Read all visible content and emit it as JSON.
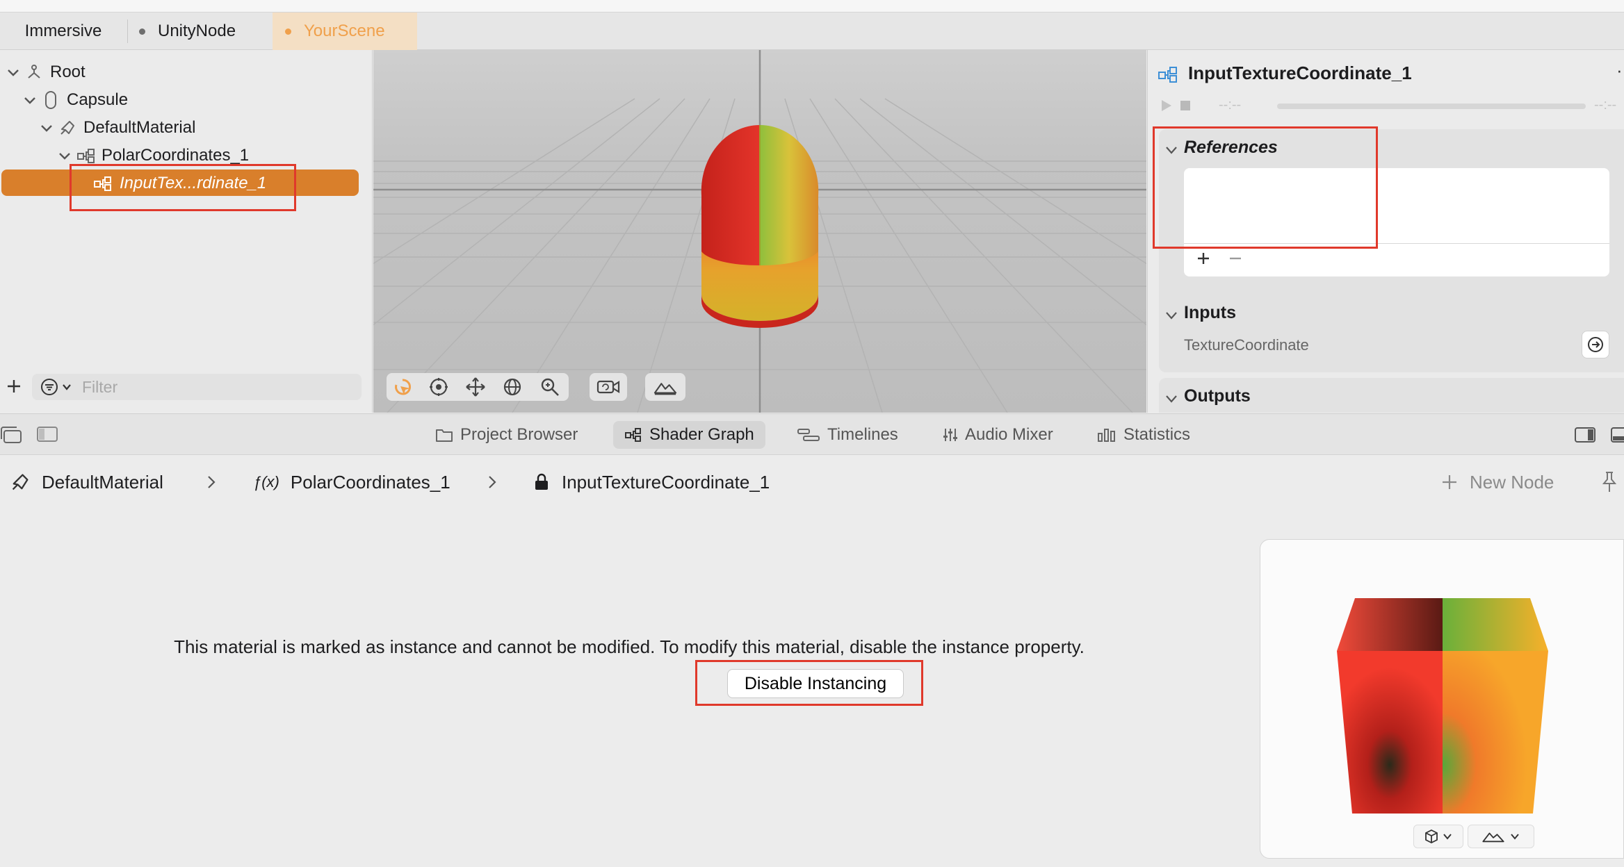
{
  "tabs": [
    {
      "label": "Immersive",
      "active": false,
      "dot": false
    },
    {
      "label": "UnityNode",
      "active": false,
      "dot": true,
      "dot_color": "#6e6e6e"
    },
    {
      "label": "YourScene",
      "active": true,
      "dot": true,
      "dot_color": "#f0a04b"
    }
  ],
  "colors": {
    "accent_orange": "#d97f2b",
    "tab_active_text": "#f0a04b",
    "tab_active_bg": "#f4dfc4",
    "highlight_red": "#e0392b"
  },
  "outline": {
    "items": [
      {
        "label": "Root",
        "icon": "hierarchy-icon",
        "expanded": true
      },
      {
        "label": "Capsule",
        "icon": "capsule-icon",
        "expanded": true
      },
      {
        "label": "DefaultMaterial",
        "icon": "material-brush-icon",
        "expanded": true
      },
      {
        "label": "PolarCoordinates_1",
        "icon": "node-graph-icon",
        "expanded": true
      },
      {
        "label": "InputTex...rdinate_1",
        "icon": "node-graph-icon",
        "selected": true
      }
    ],
    "filter_placeholder": "Filter"
  },
  "inspector": {
    "title": "InputTextureCoordinate_1",
    "time_left": "--:--",
    "time_right": "--:--",
    "references_title": "References",
    "inputs_title": "Inputs",
    "input_items": [
      "TextureCoordinate"
    ],
    "outputs_title": "Outputs"
  },
  "bottom_tabs": [
    {
      "label": "Project Browser",
      "icon": "folder-icon",
      "active": false
    },
    {
      "label": "Shader Graph",
      "icon": "node-graph-icon",
      "active": true
    },
    {
      "label": "Timelines",
      "icon": "timeline-icon",
      "active": false
    },
    {
      "label": "Audio Mixer",
      "icon": "sliders-icon",
      "active": false
    },
    {
      "label": "Statistics",
      "icon": "bar-chart-icon",
      "active": false
    }
  ],
  "breadcrumb": {
    "items": [
      {
        "label": "DefaultMaterial",
        "icon": "material-brush-icon"
      },
      {
        "label": "PolarCoordinates_1",
        "icon": "function-icon",
        "icon_text": "ƒ(x)"
      },
      {
        "label": "InputTextureCoordinate_1",
        "icon": "lock-icon"
      }
    ],
    "new_node_label": "New Node"
  },
  "graph": {
    "message": "This material is marked as instance and cannot be modified. To modify this material, disable the instance property.",
    "disable_button": "Disable Instancing"
  }
}
